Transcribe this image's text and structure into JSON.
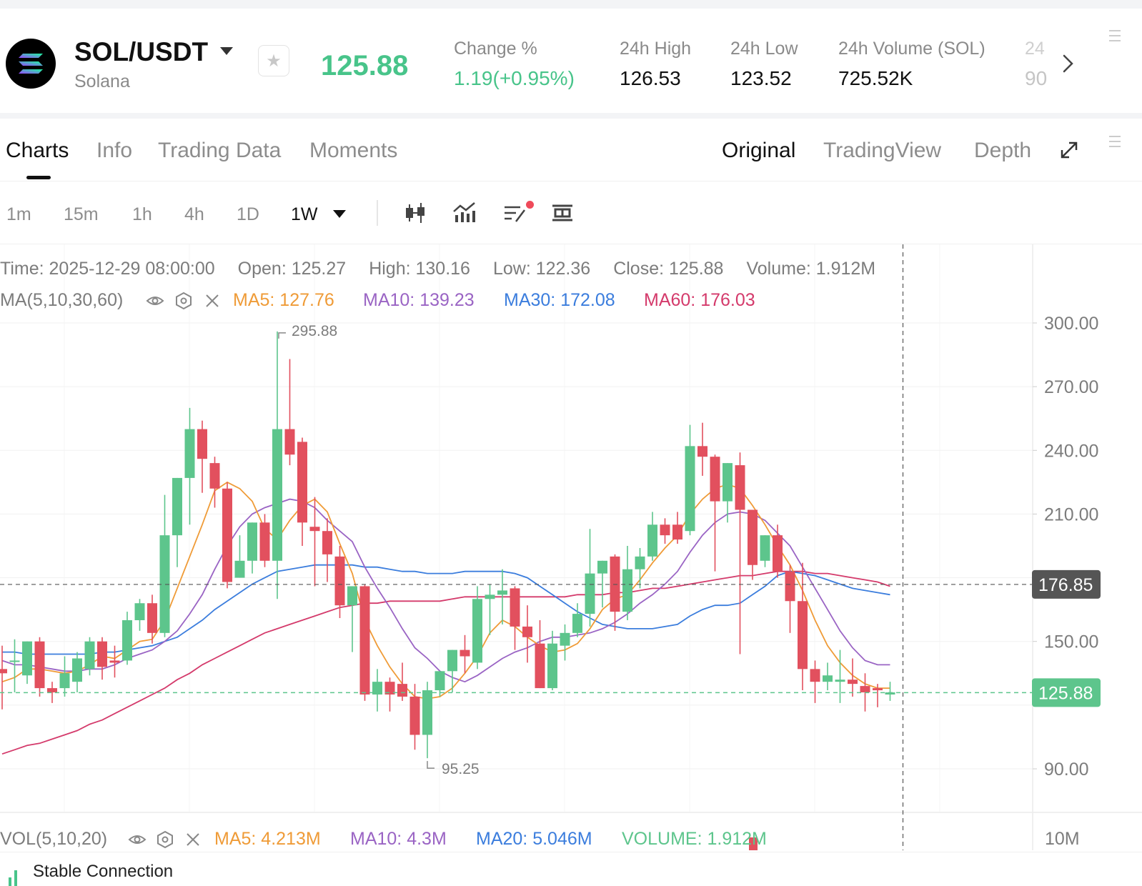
{
  "header": {
    "pair": "SOL/USDT",
    "name": "Solana",
    "last_price": "125.88",
    "stats": [
      {
        "label": "Change %",
        "value": "1.19(+0.95%)",
        "green": true
      },
      {
        "label": "24h High",
        "value": "126.53"
      },
      {
        "label": "24h Low",
        "value": "123.52"
      },
      {
        "label": "24h Volume (SOL)",
        "value": "725.52K"
      }
    ],
    "cut_label": "24",
    "cut_value": "90"
  },
  "tabs": {
    "left": [
      "Charts",
      "Info",
      "Trading Data",
      "Moments"
    ],
    "right": [
      "Original",
      "TradingView",
      "Depth"
    ]
  },
  "toolbar": {
    "timeframes": [
      "1m",
      "15m",
      "1h",
      "4h",
      "1D",
      "1W"
    ],
    "active_timeframe": "1W"
  },
  "info": {
    "time": "Time: 2025-12-29 08:00:00",
    "open": "Open: 125.27",
    "high": "High: 130.16",
    "low": "Low: 122.36",
    "close": "Close: 125.88",
    "volume": "Volume: 1.912M"
  },
  "ma": {
    "label": "MA(5,10,30,60)",
    "ma5": "MA5: 127.76",
    "ma10": "MA10: 139.23",
    "ma30": "MA30: 172.08",
    "ma60": "MA60: 176.03"
  },
  "vol": {
    "label": "VOL(5,10,20)",
    "ma5": "MA5: 4.213M",
    "ma10": "MA10: 4.3M",
    "ma20": "MA20: 5.046M",
    "volume": "VOLUME: 1.912M",
    "axis_label": "10M"
  },
  "status": {
    "text": "Stable Connection"
  },
  "colors": {
    "up": "#5dc58c",
    "down": "#e2505e",
    "ma5": "#ef9b37",
    "ma10": "#9a64c4",
    "ma30": "#3b7ddd",
    "ma60": "#d43a6b"
  },
  "chart_data": {
    "type": "candlestick",
    "interval": "1W",
    "y_ticks": [
      "300.00",
      "270.00",
      "240.00",
      "210.00",
      "150.00",
      "90.00"
    ],
    "crosshair_price": "176.85",
    "last_price_tag": "125.88",
    "high_marker": "295.88",
    "low_marker": "95.25",
    "candles": [
      {
        "o": 137,
        "h": 148,
        "l": 118,
        "c": 135
      },
      {
        "o": 141,
        "h": 151,
        "l": 126,
        "c": 141
      },
      {
        "o": 134,
        "h": 150,
        "l": 130,
        "c": 150
      },
      {
        "o": 150,
        "h": 152,
        "l": 124,
        "c": 128
      },
      {
        "o": 128,
        "h": 131,
        "l": 121,
        "c": 126
      },
      {
        "o": 128,
        "h": 143,
        "l": 124,
        "c": 135
      },
      {
        "o": 131,
        "h": 145,
        "l": 126,
        "c": 142
      },
      {
        "o": 137,
        "h": 152,
        "l": 134,
        "c": 150
      },
      {
        "o": 150,
        "h": 152,
        "l": 132,
        "c": 138
      },
      {
        "o": 141,
        "h": 148,
        "l": 133,
        "c": 140
      },
      {
        "o": 141,
        "h": 164,
        "l": 139,
        "c": 160
      },
      {
        "o": 160,
        "h": 170,
        "l": 155,
        "c": 168
      },
      {
        "o": 168,
        "h": 172,
        "l": 149,
        "c": 154
      },
      {
        "o": 154,
        "h": 219,
        "l": 152,
        "c": 200
      },
      {
        "o": 200,
        "h": 224,
        "l": 185,
        "c": 227
      },
      {
        "o": 227,
        "h": 260,
        "l": 205,
        "c": 250
      },
      {
        "o": 250,
        "h": 254,
        "l": 220,
        "c": 236
      },
      {
        "o": 234,
        "h": 237,
        "l": 213,
        "c": 222
      },
      {
        "o": 222,
        "h": 225,
        "l": 175,
        "c": 178
      },
      {
        "o": 180,
        "h": 200,
        "l": 180,
        "c": 188
      },
      {
        "o": 188,
        "h": 205,
        "l": 182,
        "c": 206
      },
      {
        "o": 206,
        "h": 210,
        "l": 185,
        "c": 188
      },
      {
        "o": 188,
        "h": 296,
        "l": 170,
        "c": 250
      },
      {
        "o": 250,
        "h": 283,
        "l": 233,
        "c": 238
      },
      {
        "o": 244,
        "h": 246,
        "l": 195,
        "c": 206
      },
      {
        "o": 204,
        "h": 218,
        "l": 176,
        "c": 202
      },
      {
        "o": 202,
        "h": 208,
        "l": 178,
        "c": 191
      },
      {
        "o": 190,
        "h": 195,
        "l": 161,
        "c": 167
      },
      {
        "o": 167,
        "h": 172,
        "l": 145,
        "c": 176
      },
      {
        "o": 176,
        "h": 177,
        "l": 122,
        "c": 125
      },
      {
        "o": 125,
        "h": 137,
        "l": 117,
        "c": 131
      },
      {
        "o": 131,
        "h": 133,
        "l": 117,
        "c": 125
      },
      {
        "o": 130,
        "h": 140,
        "l": 122,
        "c": 124
      },
      {
        "o": 124,
        "h": 130,
        "l": 99,
        "c": 106
      },
      {
        "o": 106,
        "h": 131,
        "l": 95,
        "c": 127
      },
      {
        "o": 127,
        "h": 136,
        "l": 124,
        "c": 136
      },
      {
        "o": 136,
        "h": 146,
        "l": 126,
        "c": 146
      },
      {
        "o": 146,
        "h": 153,
        "l": 135,
        "c": 143
      },
      {
        "o": 140,
        "h": 176,
        "l": 137,
        "c": 170
      },
      {
        "o": 170,
        "h": 177,
        "l": 153,
        "c": 172
      },
      {
        "o": 172,
        "h": 184,
        "l": 158,
        "c": 174
      },
      {
        "o": 175,
        "h": 176,
        "l": 146,
        "c": 157
      },
      {
        "o": 157,
        "h": 167,
        "l": 140,
        "c": 152
      },
      {
        "o": 149,
        "h": 160,
        "l": 133,
        "c": 128
      },
      {
        "o": 128,
        "h": 155,
        "l": 127,
        "c": 149
      },
      {
        "o": 148,
        "h": 158,
        "l": 141,
        "c": 154
      },
      {
        "o": 154,
        "h": 168,
        "l": 152,
        "c": 163
      },
      {
        "o": 163,
        "h": 203,
        "l": 157,
        "c": 182
      },
      {
        "o": 182,
        "h": 185,
        "l": 166,
        "c": 188
      },
      {
        "o": 190,
        "h": 191,
        "l": 155,
        "c": 164
      },
      {
        "o": 164,
        "h": 195,
        "l": 160,
        "c": 184
      },
      {
        "o": 184,
        "h": 194,
        "l": 175,
        "c": 190
      },
      {
        "o": 190,
        "h": 211,
        "l": 188,
        "c": 205
      },
      {
        "o": 205,
        "h": 208,
        "l": 196,
        "c": 200
      },
      {
        "o": 205,
        "h": 211,
        "l": 196,
        "c": 198
      },
      {
        "o": 202,
        "h": 252,
        "l": 200,
        "c": 242
      },
      {
        "o": 242,
        "h": 253,
        "l": 228,
        "c": 237
      },
      {
        "o": 237,
        "h": 238,
        "l": 183,
        "c": 216
      },
      {
        "o": 216,
        "h": 232,
        "l": 206,
        "c": 234
      },
      {
        "o": 233,
        "h": 239,
        "l": 144,
        "c": 212
      },
      {
        "o": 212,
        "h": 207,
        "l": 179,
        "c": 186
      },
      {
        "o": 188,
        "h": 200,
        "l": 185,
        "c": 200
      },
      {
        "o": 200,
        "h": 205,
        "l": 180,
        "c": 183
      },
      {
        "o": 183,
        "h": 186,
        "l": 154,
        "c": 169
      },
      {
        "o": 169,
        "h": 187,
        "l": 127,
        "c": 137
      },
      {
        "o": 137,
        "h": 141,
        "l": 121,
        "c": 131
      },
      {
        "o": 131,
        "h": 140,
        "l": 127,
        "c": 134
      },
      {
        "o": 131,
        "h": 146,
        "l": 121,
        "c": 132
      },
      {
        "o": 132,
        "h": 142,
        "l": 124,
        "c": 130
      },
      {
        "o": 129,
        "h": 135,
        "l": 117,
        "c": 126
      },
      {
        "o": 128,
        "h": 130,
        "l": 119,
        "c": 127
      },
      {
        "o": 125,
        "h": 131,
        "l": 122,
        "c": 126
      }
    ],
    "ma5": [
      131,
      133,
      137,
      137,
      136,
      135,
      136,
      139,
      143,
      142,
      146,
      150,
      151,
      160,
      175,
      190,
      205,
      221,
      225,
      222,
      216,
      203,
      198,
      207,
      214,
      217,
      211,
      196,
      182,
      160,
      148,
      138,
      130,
      124,
      123,
      124,
      128,
      135,
      143,
      154,
      160,
      157,
      152,
      148,
      145,
      146,
      149,
      156,
      165,
      170,
      172,
      179,
      187,
      194,
      200,
      210,
      217,
      222,
      224,
      222,
      214,
      205,
      195,
      186,
      174,
      160,
      148,
      140,
      134,
      130,
      128,
      128
    ],
    "ma10": [
      141,
      139,
      139,
      138,
      137,
      136,
      136,
      137,
      137,
      139,
      142,
      144,
      146,
      150,
      155,
      163,
      172,
      184,
      195,
      204,
      210,
      213,
      215,
      217,
      216,
      213,
      207,
      202,
      197,
      185,
      175,
      166,
      156,
      147,
      142,
      136,
      133,
      131,
      134,
      138,
      142,
      145,
      147,
      150,
      152,
      152,
      153,
      154,
      156,
      159,
      163,
      168,
      172,
      177,
      183,
      192,
      200,
      206,
      210,
      211,
      210,
      207,
      201,
      195,
      185,
      175,
      165,
      155,
      147,
      141,
      139,
      139
    ],
    "ma30": [
      145,
      145,
      144,
      144,
      144,
      144,
      144,
      144,
      145,
      145,
      146,
      147,
      148,
      150,
      152,
      156,
      160,
      165,
      169,
      173,
      177,
      180,
      183,
      184,
      185,
      186,
      186,
      186,
      186,
      185,
      185,
      184,
      183,
      183,
      182,
      182,
      182,
      183,
      183,
      183,
      183,
      182,
      180,
      176,
      172,
      168,
      164,
      161,
      158,
      157,
      156,
      156,
      156,
      157,
      158,
      162,
      165,
      167,
      167,
      168,
      172,
      176,
      181,
      183,
      182,
      181,
      179,
      177,
      175,
      174,
      173,
      172
    ],
    "ma60": [
      97,
      99,
      101,
      102,
      104,
      106,
      108,
      111,
      113,
      116,
      119,
      122,
      125,
      128,
      132,
      135,
      139,
      142,
      145,
      148,
      151,
      154,
      156,
      158,
      160,
      162,
      164,
      166,
      167,
      168,
      168,
      169,
      169,
      169,
      169,
      169,
      170,
      171,
      171,
      171,
      171,
      171,
      171,
      171,
      171,
      171,
      172,
      172,
      172,
      173,
      173,
      174,
      175,
      175,
      176,
      177,
      178,
      179,
      180,
      181,
      181,
      182,
      183,
      183,
      183,
      182,
      182,
      181,
      180,
      179,
      178,
      176
    ]
  }
}
